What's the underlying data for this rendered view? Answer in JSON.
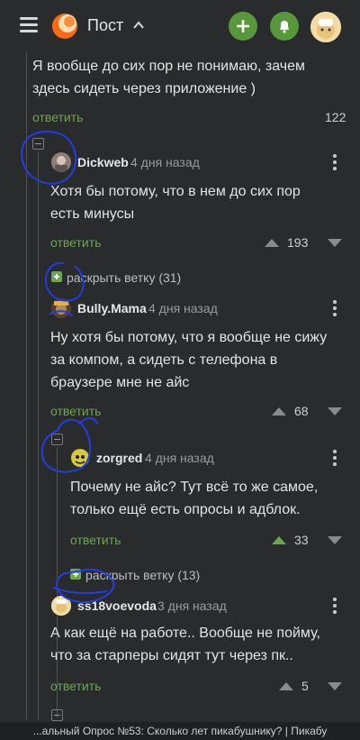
{
  "header": {
    "title": "Пост"
  },
  "comments": [
    {
      "text": "Я вообще до сих пор не понимаю, зачем здесь сидеть через приложение )",
      "line1": "Я вообще до сих пор не понимаю, зачем",
      "line2": "здесь сидеть через приложение )",
      "reply": "ответить",
      "votes": "122"
    },
    {
      "author": "Dickweb",
      "date": "4 дня назад",
      "line1": "Хотя бы потому, что в нем до сих пор",
      "line2": "есть минусы",
      "reply": "ответить",
      "votes": "193"
    },
    {
      "expand": "раскрыть ветку (31)"
    },
    {
      "author": "Bully.Mama",
      "date": "4 дня назад",
      "line1": "Ну хотя бы потому, что я вообще не сижу",
      "line2": "за компом, а сидеть с телефона в",
      "line3": "браузере мне не айс",
      "reply": "ответить",
      "votes": "68"
    },
    {
      "author": "zorgred",
      "date": "4 дня назад",
      "line1": "Почему не айс? Тут всё то же самое,",
      "line2": "только ещё есть опросы и адблок.",
      "reply": "ответить",
      "votes": "33"
    },
    {
      "expand": "раскрыть ветку (13)"
    },
    {
      "author": "ss18voevoda",
      "date": "3 дня назад",
      "line1": "А как ещё на работе.. Вообще не пойму,",
      "line2": "что за старперы сидят тут через пк..",
      "reply": "ответить",
      "votes": "5"
    }
  ],
  "footer": {
    "text": "...альный Опрос №53: Сколько лет пикабушнику? | Пикабу"
  },
  "colors": {
    "accent": "#6aa84f",
    "background": "#2a2b2d",
    "annotation": "#1f3fe0"
  }
}
